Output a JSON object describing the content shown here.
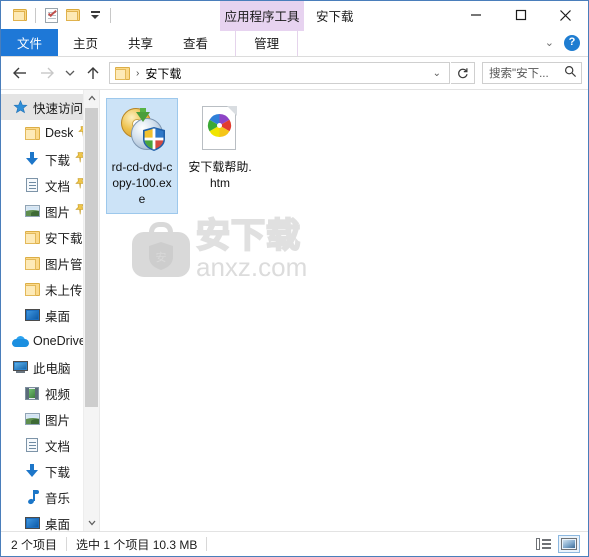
{
  "window": {
    "title": "安下载",
    "contextual_tab_group": "应用程序工具",
    "controls": {
      "minimize": "minimize-icon",
      "maximize": "maximize-icon",
      "close": "close-icon"
    }
  },
  "quick_access_toolbar": {
    "items": [
      {
        "name": "folder-properties-icon",
        "label": ""
      },
      {
        "name": "properties-icon",
        "label": ""
      },
      {
        "name": "new-folder-icon",
        "label": ""
      },
      {
        "name": "customize-dropdown-icon",
        "label": ""
      }
    ]
  },
  "ribbon": {
    "tabs": [
      {
        "label": "文件",
        "active": true
      },
      {
        "label": "主页",
        "active": false
      },
      {
        "label": "共享",
        "active": false
      },
      {
        "label": "查看",
        "active": false
      },
      {
        "label": "管理",
        "active": false,
        "contextual": true
      }
    ],
    "collapse_label": "⌄",
    "help_label": "?"
  },
  "addressbar": {
    "back": "back-arrow-icon",
    "forward": "forward-arrow-icon",
    "recent": "recent-locations-icon",
    "up": "up-arrow-icon",
    "breadcrumb": [
      "安下载"
    ],
    "breadcrumb_separator": "›",
    "dropdown": "⌄",
    "refresh": "refresh-icon",
    "search_placeholder": "搜索\"安下...",
    "search_value": ""
  },
  "sidebar": {
    "items": [
      {
        "label": "快速访问",
        "icon": "star-icon",
        "level": 0,
        "selected": true,
        "pinned": false
      },
      {
        "label": "Desk",
        "icon": "folder-icon",
        "level": 1,
        "selected": false,
        "pinned": true
      },
      {
        "label": "下载",
        "icon": "download-icon",
        "level": 1,
        "selected": false,
        "pinned": true
      },
      {
        "label": "文档",
        "icon": "document-icon",
        "level": 1,
        "selected": false,
        "pinned": true
      },
      {
        "label": "图片",
        "icon": "pictures-icon",
        "level": 1,
        "selected": false,
        "pinned": true
      },
      {
        "label": "安下载",
        "icon": "folder-icon",
        "level": 1,
        "selected": false,
        "pinned": false
      },
      {
        "label": "图片管理",
        "icon": "folder-icon",
        "level": 1,
        "selected": false,
        "pinned": false
      },
      {
        "label": "未上传",
        "icon": "folder-icon",
        "level": 1,
        "selected": false,
        "pinned": false
      },
      {
        "label": "桌面",
        "icon": "desktop-icon",
        "level": 1,
        "selected": false,
        "pinned": false
      },
      {
        "label": "OneDrive",
        "icon": "onedrive-icon",
        "level": 0,
        "selected": false,
        "pinned": false
      },
      {
        "label": "此电脑",
        "icon": "this-pc-icon",
        "level": 0,
        "selected": false,
        "pinned": false
      },
      {
        "label": "视频",
        "icon": "videos-icon",
        "level": 1,
        "selected": false,
        "pinned": false
      },
      {
        "label": "图片",
        "icon": "pictures-icon",
        "level": 1,
        "selected": false,
        "pinned": false
      },
      {
        "label": "文档",
        "icon": "document-icon",
        "level": 1,
        "selected": false,
        "pinned": false
      },
      {
        "label": "下载",
        "icon": "download-icon",
        "level": 1,
        "selected": false,
        "pinned": false
      },
      {
        "label": "音乐",
        "icon": "music-icon",
        "level": 1,
        "selected": false,
        "pinned": false
      },
      {
        "label": "桌面",
        "icon": "desktop-icon",
        "level": 1,
        "selected": false,
        "pinned": false
      }
    ],
    "scroll": {
      "up": "▲",
      "down": "▼",
      "thumb_percent": 73
    }
  },
  "files": [
    {
      "name": "rd-cd-dvd-copy-100.exe",
      "icon": "cd-dvd-copy-exe-icon",
      "selected": true
    },
    {
      "name": "安下载帮助.htm",
      "icon": "html-document-icon",
      "selected": false
    }
  ],
  "watermark": {
    "cn_text": "安下载",
    "en_text": "anxz.com",
    "shield_text": "安"
  },
  "statusbar": {
    "item_count": "2 个项目",
    "selection": "选中 1 个项目  10.3 MB",
    "views": [
      {
        "name": "details-view-button",
        "active": false
      },
      {
        "name": "large-icons-view-button",
        "active": true
      }
    ]
  },
  "colors": {
    "accent": "#1e78d7",
    "contextual_tab": "#e7d3f0",
    "selection": "#cce3f7",
    "selection_border": "#9dc8ec"
  }
}
